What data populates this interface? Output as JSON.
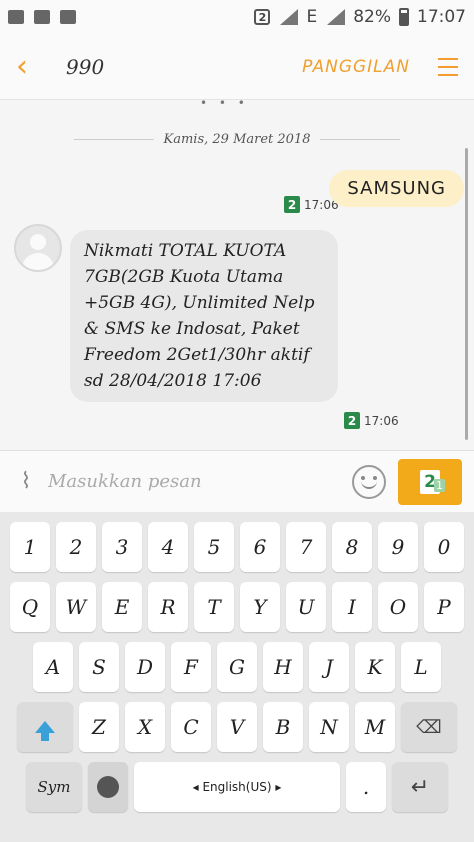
{
  "status": {
    "sim_label": "2",
    "network": "E",
    "battery": "82%",
    "time": "17:07"
  },
  "header": {
    "contact": "990",
    "call_label": "PANGGILAN"
  },
  "conversation": {
    "date_divider": "Kamis, 29 Maret 2018",
    "sent": {
      "text": "SAMSUNG",
      "sim": "2",
      "time": "17:06"
    },
    "received": {
      "text": "Nikmati TOTAL KUOTA 7GB(2GB Kuota Utama +5GB 4G), Unlimited Nelp & SMS ke Indosat, Paket Freedom 2Get1/30hr aktif sd 28/04/2018 17:06",
      "sim": "2",
      "time": "17:06"
    }
  },
  "composer": {
    "placeholder": "Masukkan pesan",
    "send_sim": "2",
    "send_sub": "1"
  },
  "keyboard": {
    "row1": [
      "1",
      "2",
      "3",
      "4",
      "5",
      "6",
      "7",
      "8",
      "9",
      "0"
    ],
    "row2": [
      "Q",
      "W",
      "E",
      "R",
      "T",
      "Y",
      "U",
      "I",
      "O",
      "P"
    ],
    "row3": [
      "A",
      "S",
      "D",
      "F",
      "G",
      "H",
      "J",
      "K",
      "L"
    ],
    "row4": [
      "Z",
      "X",
      "C",
      "V",
      "B",
      "N",
      "M"
    ],
    "sym_label": "Sym",
    "space_label": "◂  English(US)  ▸",
    "period": "."
  }
}
